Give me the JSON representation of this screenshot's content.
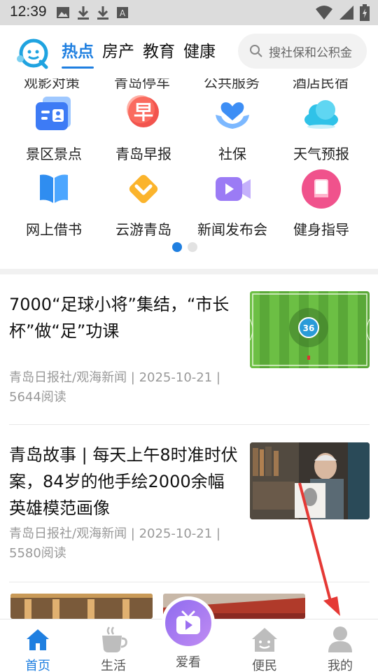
{
  "statusbar": {
    "time": "12:39",
    "left_icons": [
      "image-icon",
      "download-icon",
      "download-icon",
      "font-a-icon"
    ],
    "right_icons": [
      "wifi-icon",
      "signal-icon",
      "battery-charging-icon"
    ]
  },
  "header": {
    "logo": "qingdao-logo-icon",
    "tabs": [
      {
        "label": "热点",
        "active": true
      },
      {
        "label": "房产",
        "active": false
      },
      {
        "label": "教育",
        "active": false
      },
      {
        "label": "健康",
        "active": false
      }
    ],
    "search_placeholder": "搜社保和公积金"
  },
  "grid": {
    "partial_row": [
      "观影对策",
      "青岛停车",
      "公共服务",
      "酒店民宿"
    ],
    "rows": [
      [
        {
          "label": "景区景点",
          "icon": "scenic-card-icon"
        },
        {
          "label": "青岛早报",
          "icon": "morning-news-icon"
        },
        {
          "label": "社保",
          "icon": "social-security-icon"
        },
        {
          "label": "天气预报",
          "icon": "weather-cloud-icon"
        }
      ],
      [
        {
          "label": "网上借书",
          "icon": "book-icon"
        },
        {
          "label": "云游青岛",
          "icon": "travel-chevron-icon"
        },
        {
          "label": "新闻发布会",
          "icon": "video-icon"
        },
        {
          "label": "健身指导",
          "icon": "fitness-book-icon"
        }
      ]
    ],
    "page_dots": 2,
    "active_dot": 0
  },
  "news": [
    {
      "title": "7000“足球小将”集结，“市长杯”做“足”功课",
      "meta": "青岛日报社/观海新闻 | 2025-10-21 | 5644阅读",
      "thumb": "football-field-image"
    },
    {
      "title": "青岛故事 | 每天上午8时准时伏案，84岁的他手绘2000余幅英雄模范画像",
      "meta": "青岛日报社/观海新闻 | 2025-10-21 | 5580阅读",
      "thumb": "elderly-artist-image"
    }
  ],
  "bottom_nav": [
    {
      "label": "首页",
      "icon": "home-icon",
      "active": true
    },
    {
      "label": "生活",
      "icon": "coffee-cup-icon",
      "active": false
    },
    {
      "label": "爱看",
      "icon": "tv-icon",
      "active": false
    },
    {
      "label": "便民",
      "icon": "smile-house-icon",
      "active": false
    },
    {
      "label": "我的",
      "icon": "person-icon",
      "active": false
    }
  ],
  "colors": {
    "accent": "#1f7fe0",
    "annotation_arrow": "#e53935",
    "center_button": "#9b6ef0"
  }
}
